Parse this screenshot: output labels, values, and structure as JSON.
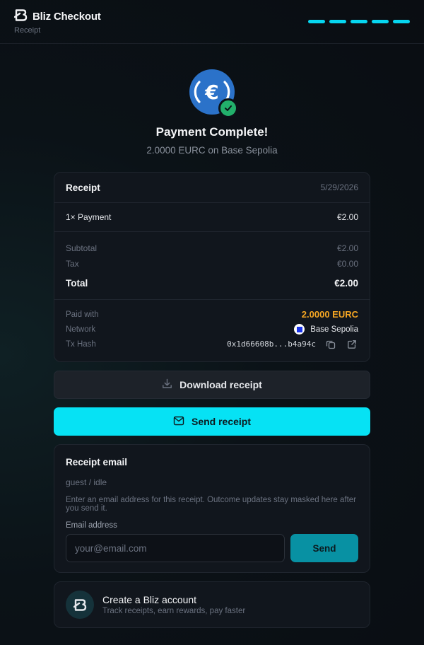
{
  "header": {
    "title": "Bliz Checkout",
    "subtitle": "Receipt",
    "steps": 5,
    "accent": "#06d6f0"
  },
  "hero": {
    "icon": "euro-coin-icon",
    "badge_icon": "check-icon",
    "title": "Payment Complete!",
    "subtitle": "2.0000 EURC on Base Sepolia"
  },
  "receipt": {
    "title": "Receipt",
    "date": "5/29/2026",
    "line_item": {
      "label": "1× Payment",
      "amount": "€2.00"
    },
    "subtotal": {
      "label": "Subtotal",
      "value": "€2.00"
    },
    "tax": {
      "label": "Tax",
      "value": "€0.00"
    },
    "total": {
      "label": "Total",
      "value": "€2.00"
    },
    "paid_with": {
      "label": "Paid with",
      "value": "2.0000 EURC",
      "color": "#f5a623"
    },
    "network": {
      "label": "Network",
      "value": "Base Sepolia",
      "icon": "base-network-icon"
    },
    "tx_hash": {
      "label": "Tx Hash",
      "value": "0x1d66608b...b4a94c",
      "copy_icon": "copy-icon",
      "open_icon": "external-link-icon"
    }
  },
  "actions": {
    "download_label": "Download receipt",
    "download_icon": "download-icon",
    "send_label": "Send receipt",
    "send_icon": "mail-icon",
    "send_color": "#06e2f4"
  },
  "email": {
    "title": "Receipt email",
    "status": "guest / idle",
    "description": "Enter an email address for this receipt. Outcome updates stay masked here after you send it.",
    "field_label": "Email address",
    "placeholder": "your@email.com",
    "value": "",
    "send_label": "Send"
  },
  "account": {
    "title": "Create a Bliz account",
    "subtitle": "Track receipts, earn rewards, pay faster"
  }
}
